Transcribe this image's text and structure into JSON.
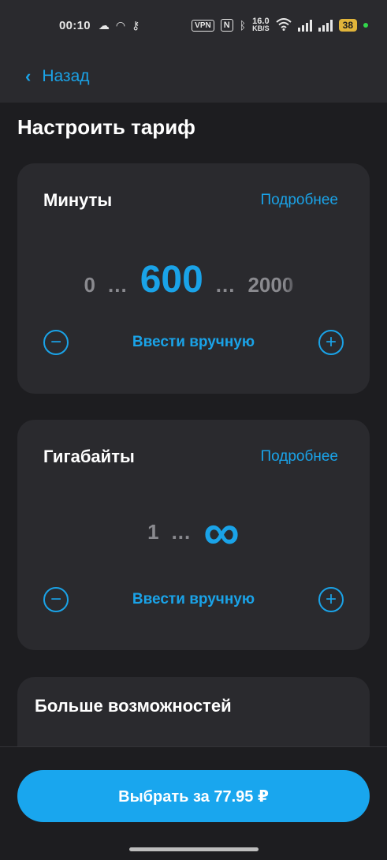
{
  "status_bar": {
    "time": "00:10",
    "vpn": "VPN",
    "nfc": "N",
    "speed_value": "16.0",
    "speed_unit": "KB/S",
    "battery": "38"
  },
  "nav": {
    "back_label": "Назад"
  },
  "page": {
    "title": "Настроить тариф"
  },
  "minutes_card": {
    "title": "Минуты",
    "more": "Подробнее",
    "min": "0",
    "dots": "...",
    "value": "600",
    "max": "2000",
    "manual": "Ввести вручную",
    "minus": "−",
    "plus": "+"
  },
  "gb_card": {
    "title": "Гигабайты",
    "more": "Подробнее",
    "min": "1",
    "dots": "...",
    "value": "∞",
    "manual": "Ввести вручную",
    "minus": "−",
    "plus": "+"
  },
  "extras_card": {
    "title": "Больше возможностей"
  },
  "cta": {
    "label": "Выбрать за 77.95 ₽"
  },
  "colors": {
    "accent": "#1aa3e8",
    "background": "#1d1d20",
    "card": "#2a2a2e"
  }
}
